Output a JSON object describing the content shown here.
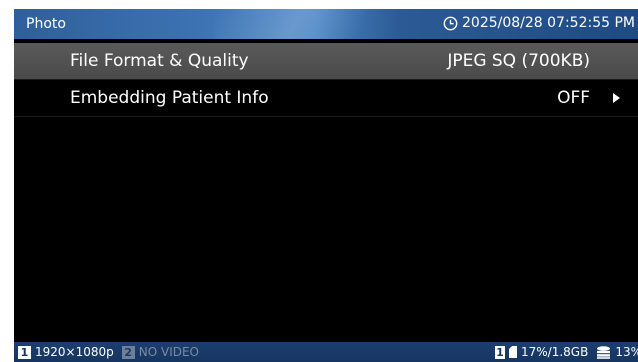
{
  "header": {
    "title": "Photo",
    "clock_icon": "clock-icon",
    "datetime": "2025/08/28 07:52:55 PM"
  },
  "menu": {
    "items": [
      {
        "label": "File Format & Quality",
        "value": "JPEG SQ (700KB)",
        "selected": true
      },
      {
        "label": "Embedding Patient Info",
        "value": "OFF",
        "arrow_icon": "right-triangle-icon"
      }
    ]
  },
  "footer": {
    "input1_number": "1",
    "input1_resolution": "1920×1080p",
    "input2_number": "2",
    "input2_status": "NO VIDEO",
    "storage_slot": "1",
    "storage_usage": "17%/1.8GB",
    "disk_icon": "disk-icon",
    "disk_usage": "13%"
  }
}
